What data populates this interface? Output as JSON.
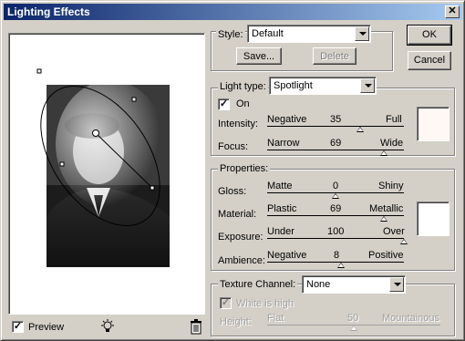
{
  "window": {
    "title": "Lighting Effects",
    "close_glyph": "✕"
  },
  "style": {
    "label": "Style:",
    "selected": "Default",
    "save_label": "Save...",
    "delete_label": "Delete"
  },
  "buttons": {
    "ok": "OK",
    "cancel": "Cancel"
  },
  "light": {
    "type_label": "Light type:",
    "type_selected": "Spotlight",
    "on_label": "On",
    "on_checked": true,
    "sliders": [
      {
        "label": "Intensity:",
        "left": "Negative",
        "value": "35",
        "right": "Full",
        "fraction": 0.68
      },
      {
        "label": "Focus:",
        "left": "Narrow",
        "value": "69",
        "right": "Wide",
        "fraction": 0.85
      }
    ],
    "color": "#fff8f4"
  },
  "properties": {
    "label": "Properties:",
    "sliders": [
      {
        "label": "Gloss:",
        "left": "Matte",
        "value": "0",
        "right": "Shiny",
        "fraction": 0.5
      },
      {
        "label": "Material:",
        "left": "Plastic",
        "value": "69",
        "right": "Metallic",
        "fraction": 0.85
      },
      {
        "label": "Exposure:",
        "left": "Under",
        "value": "100",
        "right": "Over",
        "fraction": 1.0
      },
      {
        "label": "Ambience:",
        "left": "Negative",
        "value": "8",
        "right": "Positive",
        "fraction": 0.54
      }
    ],
    "color": "#ffffff"
  },
  "texture": {
    "label": "Texture Channel:",
    "selected": "None",
    "white_is_high_label": "White is high",
    "white_is_high_checked": true,
    "height_label": "Height:",
    "height_left": "Flat",
    "height_value": "50",
    "height_right": "Mountainous",
    "height_fraction": 0.5
  },
  "preview": {
    "label": "Preview",
    "checked": true,
    "light_bulb_icon": "light-bulb-icon",
    "trash_icon": "trash-icon"
  }
}
